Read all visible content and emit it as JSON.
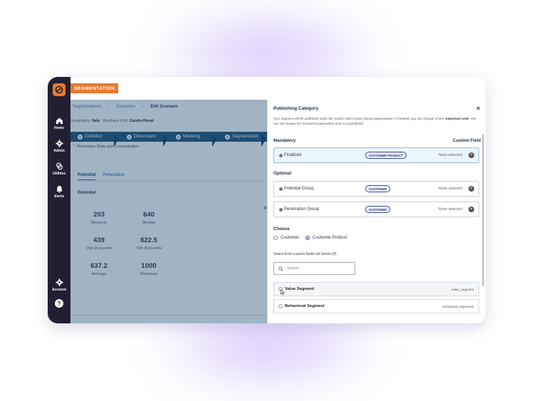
{
  "app": {
    "section_badge": "SEGMENTATION"
  },
  "sidebar": {
    "items": [
      {
        "label": "Home",
        "icon": "home-icon"
      },
      {
        "label": "Admin",
        "icon": "gear-icon"
      },
      {
        "label": "Utilities",
        "icon": "link-icon"
      },
      {
        "label": "Alerts",
        "icon": "bell-icon"
      }
    ],
    "account_label": "Account",
    "help_label": "?"
  },
  "main": {
    "breadcrumb": [
      "Segmentations",
      "Scenarios",
      "Edit Scenario"
    ],
    "geography_label": "Geography:",
    "geography_value": "Italy",
    "business_unit_label": "Business Unit:",
    "business_unit_value": "Cardio-Renal",
    "steps": [
      {
        "num": "1",
        "label": "Definition"
      },
      {
        "num": "2",
        "label": "Dimensions"
      },
      {
        "num": "3",
        "label": "Modeling"
      },
      {
        "num": "4",
        "label": "Segmentation"
      }
    ],
    "dimension_title": "Dimension Stats and Concentration",
    "tabs": [
      "Potential",
      "Penetration"
    ],
    "potential_label": "Potential",
    "side_letter": "P",
    "stats": [
      {
        "value": "203",
        "label": "Minimum"
      },
      {
        "value": "640",
        "label": "Median"
      },
      {
        "value": "439",
        "label": "25th Percentile"
      },
      {
        "value": "822.5",
        "label": "75th Percentile"
      },
      {
        "value": "637.2",
        "label": "Average"
      },
      {
        "value": "1000",
        "label": "Maximum"
      }
    ]
  },
  "panel": {
    "title": "Publishing Category",
    "description_prefix": "Your segment will be published under the custom field chosen during segmentation. If needed, you can change it here.",
    "important_label": "Important note:",
    "description_suffix": "You can not change the scenario's parameters once it is published.",
    "mandatory_heading": "Mandatory",
    "custom_field_heading": "Custom Field",
    "optional_heading": "Optional",
    "mandatory_rows": [
      {
        "name": "Finalized",
        "tag": "CUSTOMER PRODUCT",
        "status": "None selected"
      }
    ],
    "optional_rows": [
      {
        "name": "Potential Group",
        "tag": "CUSTOMER",
        "status": "None selected"
      },
      {
        "name": "Penetration Group",
        "tag": "CUSTOMER",
        "status": "None selected"
      }
    ],
    "choose_heading": "Choose",
    "choose_options": [
      {
        "label": "Customer",
        "selected": false
      },
      {
        "label": "Customer Product",
        "selected": true
      }
    ],
    "list_hint": "Select from custom fields list below (4)",
    "search_placeholder": "Search",
    "custom_fields": [
      {
        "name": "Value Segment",
        "key": "value_segment"
      },
      {
        "name": "Behavioral Segment",
        "key": "behavioral_segments"
      }
    ],
    "close_label": "×"
  },
  "colors": {
    "accent_orange": "#e8792d",
    "sidebar_dark": "#221f33",
    "step_blue": "#1f4d73",
    "tag_border": "#3a4b9a"
  }
}
